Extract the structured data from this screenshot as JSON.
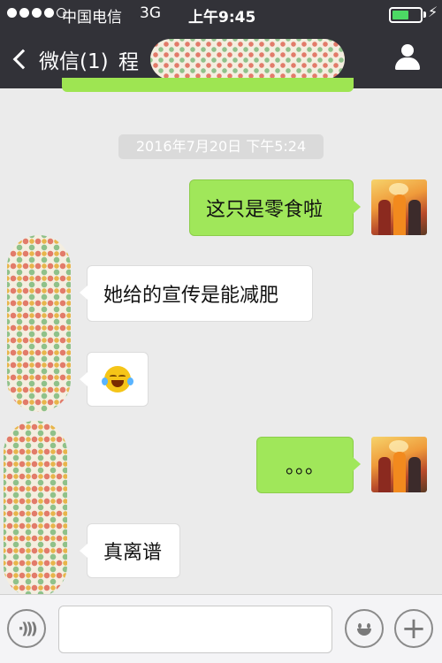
{
  "status_bar": {
    "carrier": "中国电信",
    "network": "3G",
    "time": "上午9:45",
    "battery_level": 0.6
  },
  "nav": {
    "back_label": "微信(1)",
    "title": "程"
  },
  "chat": {
    "timestamp": "2016年7月20日 下午5:24",
    "messages": [
      {
        "side": "out",
        "text": "这只是零食啦"
      },
      {
        "side": "in",
        "text": "她给的宣传是能减肥"
      },
      {
        "side": "in",
        "text": "",
        "emoji": "tears-of-joy-emoji"
      },
      {
        "side": "out",
        "text": "。。。"
      },
      {
        "side": "in",
        "text": "真离谱"
      }
    ]
  },
  "colors": {
    "nav_bg": "#323238",
    "chat_bg": "#ebebeb",
    "outgoing_bubble": "#a0e75a",
    "incoming_bubble": "#ffffff"
  },
  "icons": {
    "back": "chevron-left-icon",
    "contact": "person-icon",
    "voice": "voice-icon",
    "emoji": "emoji-face-icon",
    "plus": "plus-icon"
  }
}
